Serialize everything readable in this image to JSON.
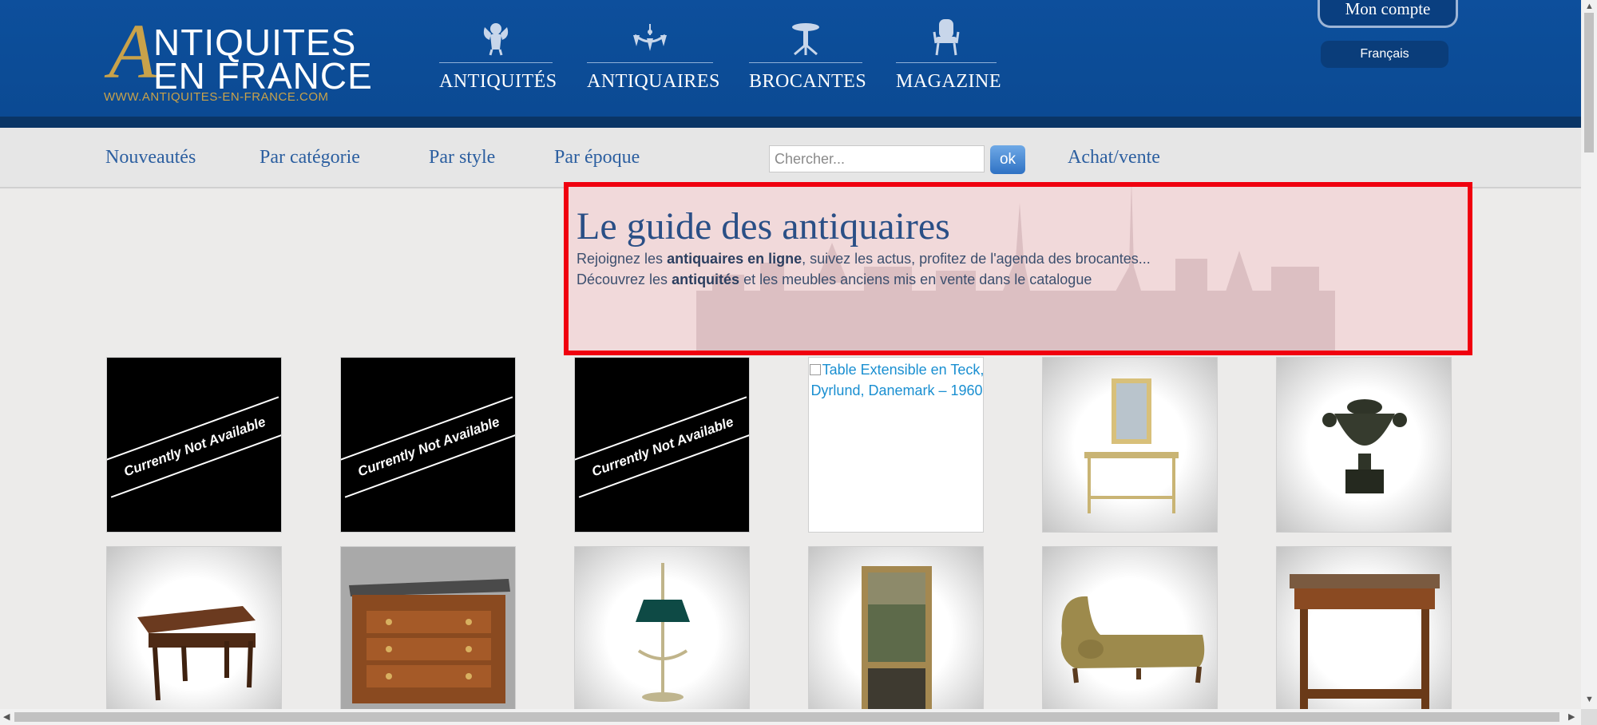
{
  "header": {
    "logo": {
      "big_letter": "A",
      "line1": "NTIQUITES",
      "line2": "EN FRANCE",
      "url": "WWW.ANTIQUITES-EN-FRANCE.COM"
    },
    "nav": [
      {
        "label": "ANTIQUITÉS",
        "icon": "cherub-icon"
      },
      {
        "label": "ANTIQUAIRES",
        "icon": "chandelier-icon"
      },
      {
        "label": "BROCANTES",
        "icon": "pedestal-table-icon"
      },
      {
        "label": "MAGAZINE",
        "icon": "armchair-icon"
      }
    ],
    "account_label": "Mon compte",
    "language_label": "Français"
  },
  "subnav": {
    "links": [
      "Nouveautés",
      "Par catégorie",
      "Par style",
      "Par époque"
    ],
    "search_placeholder": "Chercher...",
    "search_button": "ok",
    "buy_sell": "Achat/vente"
  },
  "hero": {
    "title": "Le guide des antiquaires",
    "line1": {
      "a": "Rejoignez les ",
      "b": "antiquaires en ligne",
      "c": ", suivez les actus, profitez de l'agenda des brocantes..."
    },
    "line2": {
      "a": "Découvrez les ",
      "b": "antiquités",
      "c": " et les meubles anciens mis en vente dans le catalogue"
    }
  },
  "products": {
    "row1": [
      {
        "kind": "unavailable",
        "text": "Currently Not Available"
      },
      {
        "kind": "unavailable",
        "text": "Currently Not Available"
      },
      {
        "kind": "unavailable",
        "text": "Currently Not Available"
      },
      {
        "kind": "broken-image",
        "alt": "Table Extensible en Teck, Dyrlund, Danemark – 1960"
      },
      {
        "kind": "photo",
        "icon": "mirror-console-icon"
      },
      {
        "kind": "photo",
        "icon": "urn-icon"
      }
    ],
    "row2": [
      {
        "kind": "photo",
        "icon": "side-table-icon"
      },
      {
        "kind": "photo",
        "icon": "commode-icon"
      },
      {
        "kind": "photo",
        "icon": "bouillotte-lamp-icon"
      },
      {
        "kind": "photo",
        "icon": "framed-painting-icon"
      },
      {
        "kind": "photo",
        "icon": "chaise-longue-icon"
      },
      {
        "kind": "photo",
        "icon": "console-table-icon"
      }
    ]
  },
  "colors": {
    "header_blue": "#0b4a93",
    "gold": "#c9a24a",
    "link_blue": "#2c5fa0",
    "hero_border": "#f0000f"
  }
}
